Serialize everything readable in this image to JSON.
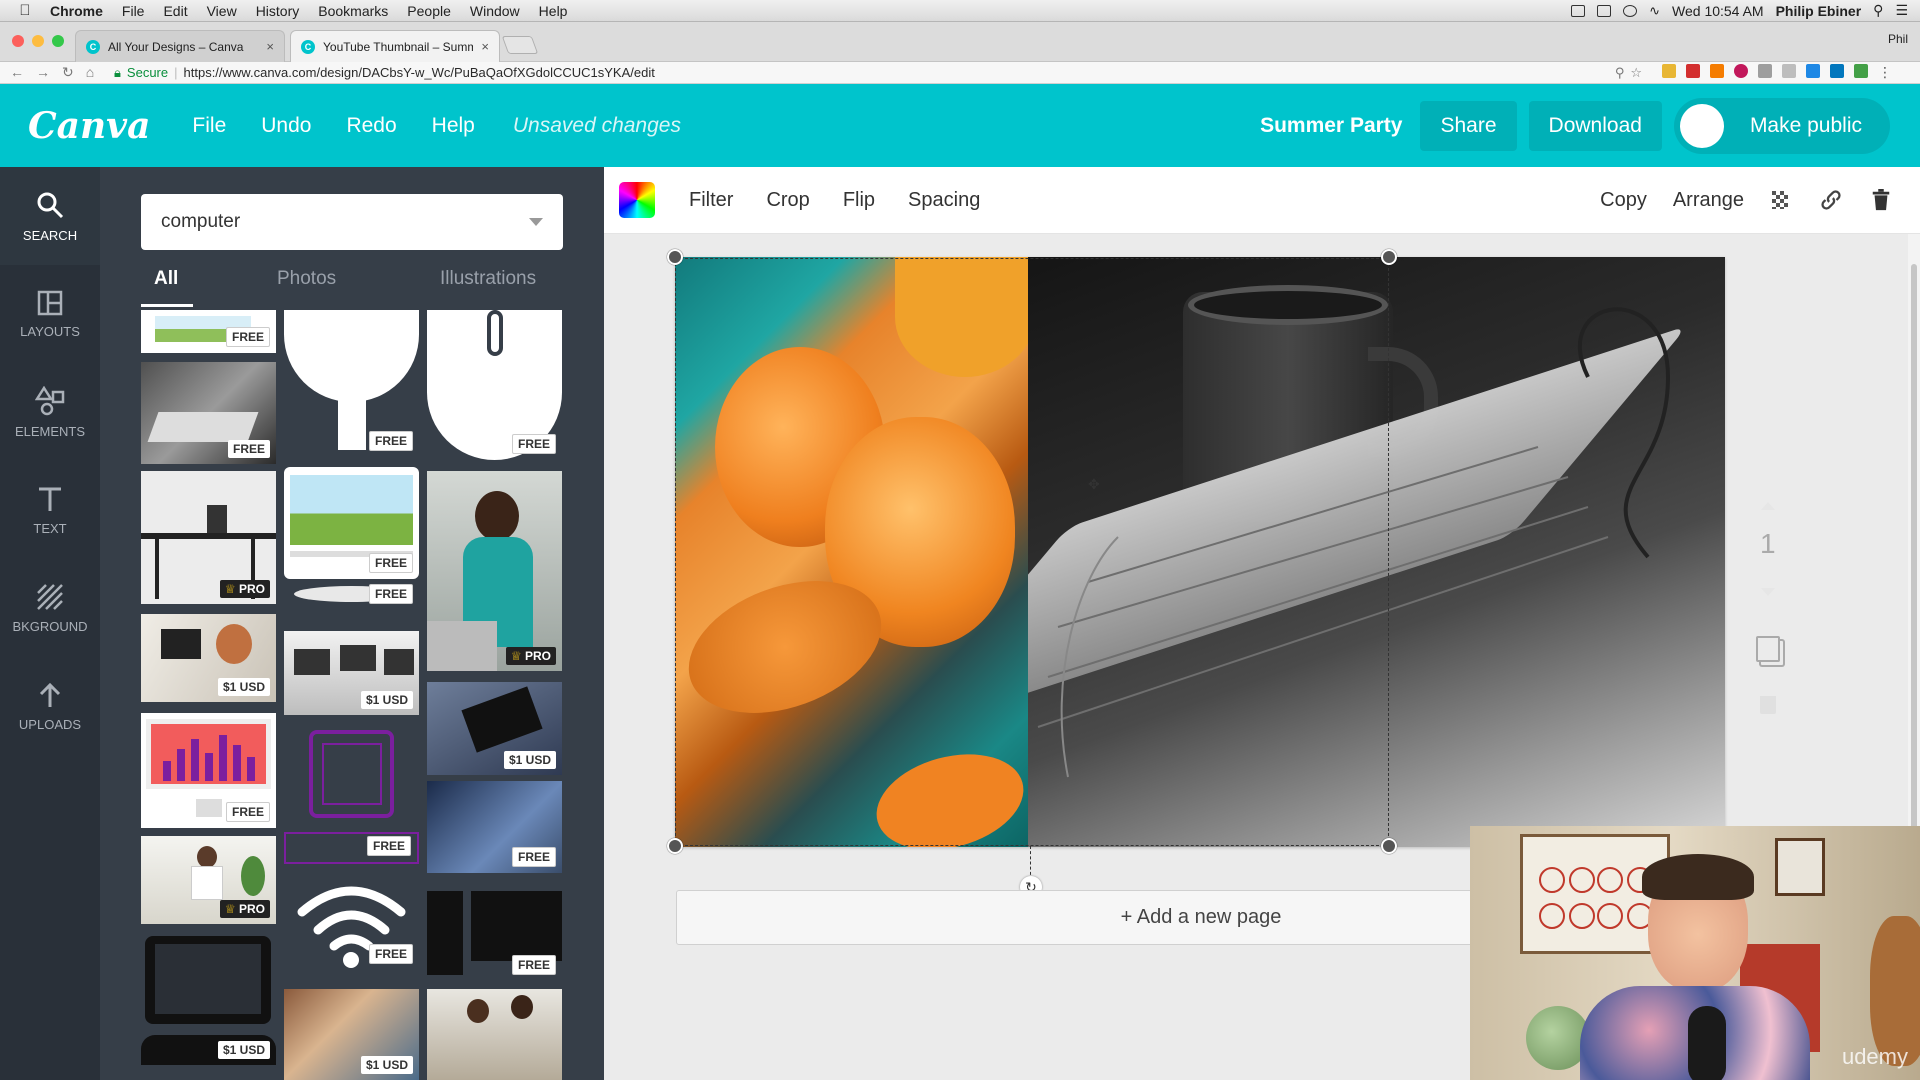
{
  "macos_menubar": {
    "app": "Chrome",
    "items": [
      "File",
      "Edit",
      "View",
      "History",
      "Bookmarks",
      "People",
      "Window",
      "Help"
    ],
    "clock": "Wed 10:54 AM",
    "user": "Philip Ebiner"
  },
  "browser": {
    "tabs": [
      {
        "title": "All Your Designs – Canva"
      },
      {
        "title": "YouTube Thumbnail – Summer"
      }
    ],
    "profile": "Phil",
    "secure_label": "Secure",
    "url": "https://www.canva.com/design/DACbsY-w_Wc/PuBaQaOfXGdolCCUC1sYKA/edit"
  },
  "topbar": {
    "logo": "Canva",
    "menu": [
      "File",
      "Undo",
      "Redo",
      "Help"
    ],
    "status": "Unsaved changes",
    "design_title": "Summer Party",
    "share": "Share",
    "download": "Download",
    "make_public": "Make public"
  },
  "sidenav": [
    {
      "label": "SEARCH",
      "icon": "search-icon"
    },
    {
      "label": "LAYOUTS",
      "icon": "layouts-icon"
    },
    {
      "label": "ELEMENTS",
      "icon": "elements-icon"
    },
    {
      "label": "TEXT",
      "icon": "text-icon"
    },
    {
      "label": "BKGROUND",
      "icon": "background-icon"
    },
    {
      "label": "UPLOADS",
      "icon": "uploads-icon"
    }
  ],
  "panel": {
    "search_value": "computer",
    "tabs": [
      "All",
      "Photos",
      "Illustrations"
    ],
    "badges": {
      "free": "FREE",
      "pro": "PRO",
      "usd": "$1 USD"
    }
  },
  "toolbar": {
    "left": [
      "Filter",
      "Crop",
      "Flip",
      "Spacing"
    ],
    "right": [
      "Copy",
      "Arrange"
    ]
  },
  "canvas": {
    "add_page": "+ Add a new page",
    "page_number": "1"
  },
  "watermark": "udemy",
  "colors": {
    "accent": "#00c4cc",
    "sidenav": "#293039",
    "panel": "#363e48"
  }
}
